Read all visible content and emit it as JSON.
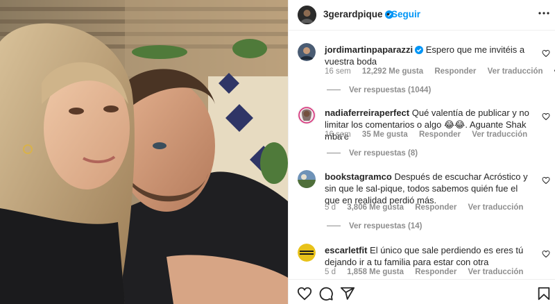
{
  "post": {
    "username": "3gerardpique",
    "verified": true,
    "separator": "•",
    "follow_label": "Seguir"
  },
  "comments": [
    {
      "username": "jordimartinpaparazzi",
      "verified": true,
      "text": "Espero que me invitéis a vuestra boda",
      "time": "16 sem",
      "likes": "12,292 Me gusta",
      "reply_label": "Responder",
      "translate_label": "Ver traducción",
      "options_label": "•••",
      "replies": "Ver respuestas (1044)"
    },
    {
      "username": "nadiaferreiraperfect",
      "verified": false,
      "text": "Qué valentía de publicar y no limitar los comentarios o algo 😂😂. Aguante Shak mba'e",
      "time": "16 sem",
      "likes": "35 Me gusta",
      "reply_label": "Responder",
      "translate_label": "Ver traducción",
      "replies": "Ver respuestas (8)"
    },
    {
      "username": "bookstagramco",
      "verified": false,
      "text": "Después de escuchar Acróstico y sin que le sal-pique, todos sabemos quién fue el que en realidad perdió más.",
      "time": "5 d",
      "likes": "3,806 Me gusta",
      "reply_label": "Responder",
      "translate_label": "Ver traducción",
      "replies": "Ver respuestas (14)"
    },
    {
      "username": "escarletfit",
      "verified": false,
      "text": "El único que sale perdiendo es eres tú dejando ir a tu familia para estar con otra",
      "time": "5 d",
      "likes": "1,858 Me gusta",
      "reply_label": "Responder",
      "translate_label": "Ver traducción"
    }
  ],
  "actions": [
    "heart-icon",
    "comment-icon",
    "share-icon",
    "bookmark-icon"
  ],
  "colors": {
    "accent": "#0095f6",
    "text": "#262626",
    "secondary": "#8e8e8e",
    "border": "#efefef"
  }
}
